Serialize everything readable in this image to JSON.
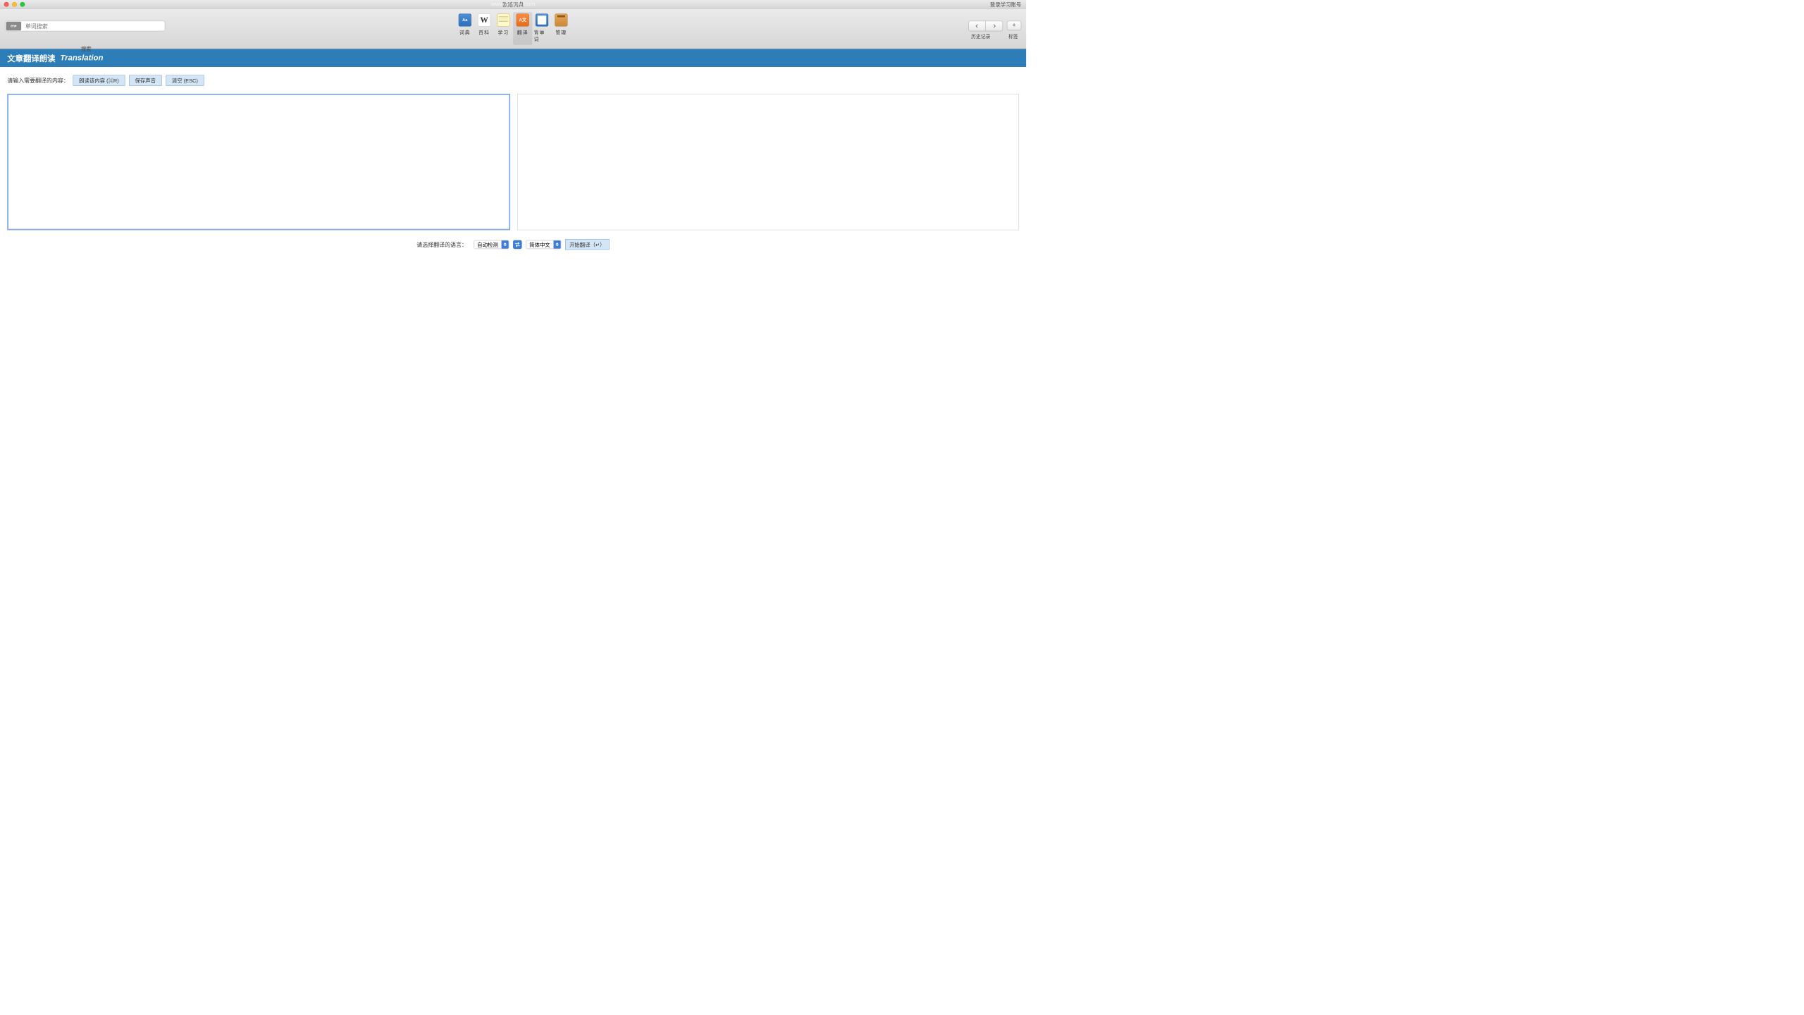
{
  "window": {
    "title": "欧路词典",
    "login_label": "登录学习账号"
  },
  "watermark": "www.MacW.com",
  "toolbar": {
    "search_placeholder": "单词搜索",
    "search_label": "搜索",
    "tabs": [
      {
        "label": "词典"
      },
      {
        "label": "百科"
      },
      {
        "label": "学习"
      },
      {
        "label": "翻译"
      },
      {
        "label": "背单词"
      },
      {
        "label": "管理"
      }
    ],
    "history_label": "历史记录",
    "bookmark_label": "标签"
  },
  "header": {
    "cn": "文章翻译朗读",
    "en": "Translation"
  },
  "content": {
    "input_prompt": "请输入需要翻译的内容：",
    "read_btn": "朗读该内容 (⌘R)",
    "save_btn": "保存声音",
    "clear_btn": "清空 (ESC)",
    "lang_prompt": "请选择翻译的语言：",
    "source_lang": "自动检测",
    "target_lang": "简体中文",
    "translate_btn": "开始翻译（↵）"
  }
}
